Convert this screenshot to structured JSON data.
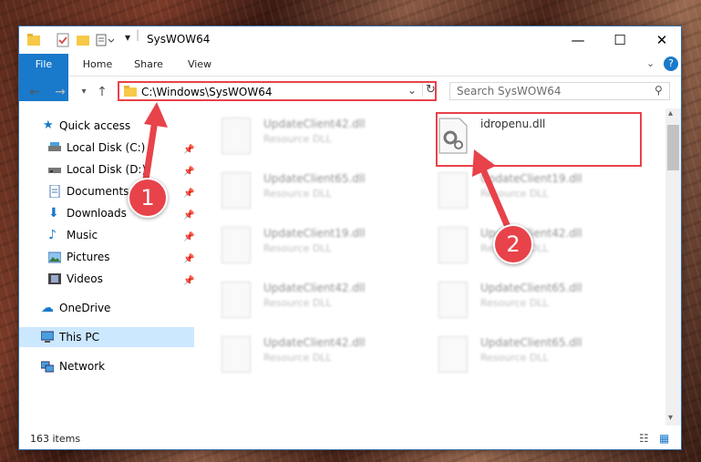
{
  "window": {
    "title": "SysWOW64"
  },
  "ribbon": {
    "tabs": [
      "File",
      "Home",
      "Share",
      "View"
    ]
  },
  "address": {
    "path": "C:\\Windows\\SysWOW64"
  },
  "search": {
    "placeholder": "Search SysWOW64"
  },
  "sidebar": {
    "items": [
      {
        "label": "Quick access",
        "icon": "star-icon"
      },
      {
        "label": "Local Disk (C:)",
        "icon": "drive-icon",
        "pinned": true
      },
      {
        "label": "Local Disk (D:)",
        "icon": "drive-icon",
        "pinned": true
      },
      {
        "label": "Documents",
        "icon": "documents-icon",
        "pinned": true
      },
      {
        "label": "Downloads",
        "icon": "download-icon",
        "pinned": true
      },
      {
        "label": "Music",
        "icon": "music-icon",
        "pinned": true
      },
      {
        "label": "Pictures",
        "icon": "pictures-icon",
        "pinned": true
      },
      {
        "label": "Videos",
        "icon": "videos-icon",
        "pinned": true
      },
      {
        "label": "OneDrive",
        "icon": "cloud-icon"
      },
      {
        "label": "This PC",
        "icon": "computer-icon",
        "selected": true
      },
      {
        "label": "Network",
        "icon": "network-icon"
      }
    ]
  },
  "files": {
    "col1": [
      {
        "name": "UpdateClient42.dll",
        "type": "Resource DLL"
      },
      {
        "name": "UpdateClient65.dll",
        "type": "Resource DLL"
      },
      {
        "name": "UpdateClient19.dll",
        "type": "Resource DLL"
      },
      {
        "name": "UpdateClient42.dll",
        "type": "Resource DLL"
      },
      {
        "name": "UpdateClient42.dll",
        "type": "Resource DLL"
      }
    ],
    "col2": [
      {
        "name": "idropenu.dll",
        "type": ""
      },
      {
        "name": "UpdateClient19.dll",
        "type": "Resource DLL"
      },
      {
        "name": "UpdateClient42.dll",
        "type": "Resource DLL"
      },
      {
        "name": "UpdateClient65.dll",
        "type": "Resource DLL"
      },
      {
        "name": "UpdateClient65.dll",
        "type": "Resource DLL"
      }
    ]
  },
  "status": {
    "count": "163 items"
  },
  "annotations": {
    "step1": "1",
    "step2": "2"
  },
  "colors": {
    "accent": "#1979ca",
    "highlight": "#e8424a"
  }
}
